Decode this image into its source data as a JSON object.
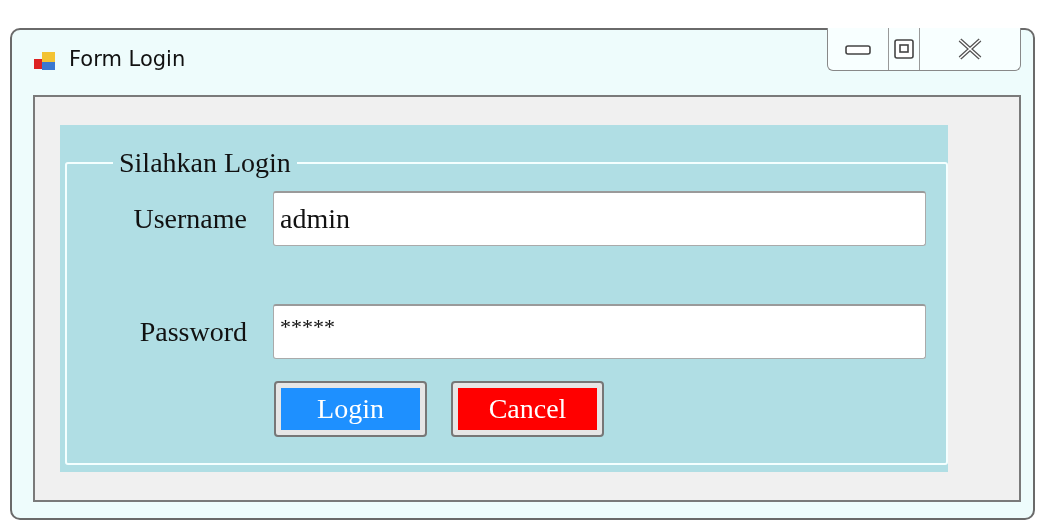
{
  "window": {
    "title": "Form Login"
  },
  "group": {
    "title": "Silahkan Login"
  },
  "fields": [
    {
      "label": "Username",
      "value": "admin",
      "kind": "text"
    },
    {
      "label": "Password",
      "value": "*****",
      "kind": "password"
    }
  ],
  "buttons": [
    {
      "label": "Login",
      "color": "#1e90ff"
    },
    {
      "label": "Cancel",
      "color": "#ff0000"
    }
  ]
}
